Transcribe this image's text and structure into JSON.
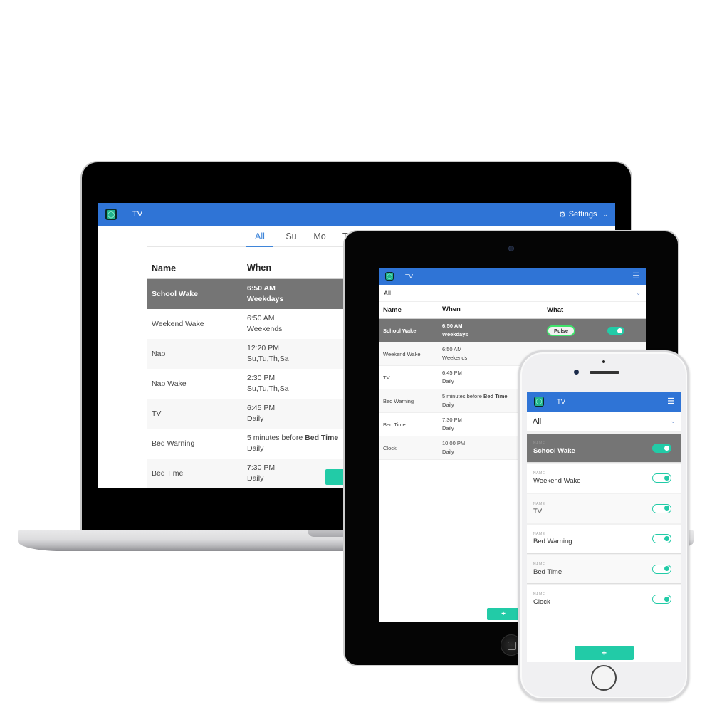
{
  "app": {
    "title": "TV",
    "logo_icon": "lightbulb-icon",
    "accent_color": "#2f74d6",
    "action_color": "#22cba7",
    "selected_row_color": "#757575"
  },
  "laptop": {
    "settings_label": "Settings",
    "settings_icon": "gear-icon",
    "day_tabs": [
      "All",
      "Su",
      "Mo",
      "Tu"
    ],
    "active_tab": "All",
    "columns": {
      "name": "Name",
      "when": "When"
    },
    "rows": [
      {
        "name": "School Wake",
        "time": "6:50 AM",
        "days": "Weekdays",
        "selected": true
      },
      {
        "name": "Weekend Wake",
        "time": "6:50 AM",
        "days": "Weekends"
      },
      {
        "name": "Nap",
        "time": "12:20 PM",
        "days": "Su,Tu,Th,Sa"
      },
      {
        "name": "Nap Wake",
        "time": "2:30 PM",
        "days": "Su,Tu,Th,Sa"
      },
      {
        "name": "TV",
        "time": "6:45 PM",
        "days": "Daily"
      },
      {
        "name": "Bed Warning",
        "time_prefix": "5 minutes before ",
        "time_ref": "Bed Time",
        "days": "Daily"
      },
      {
        "name": "Bed Time",
        "time": "7:30 PM",
        "days": "Daily"
      }
    ]
  },
  "tablet": {
    "filter_value": "All",
    "columns": {
      "name": "Name",
      "when": "When",
      "what": "What"
    },
    "rows": [
      {
        "name": "School Wake",
        "time": "6:50 AM",
        "days": "Weekdays",
        "what": "Pulse",
        "enabled": true,
        "selected": true
      },
      {
        "name": "Weekend Wake",
        "time": "6:50 AM",
        "days": "Weekends"
      },
      {
        "name": "TV",
        "time": "6:45 PM",
        "days": "Daily"
      },
      {
        "name": "Bed Warning",
        "time_prefix": "5 minutes before ",
        "time_ref": "Bed Time",
        "days": "Daily"
      },
      {
        "name": "Bed Time",
        "time": "7:30 PM",
        "days": "Daily"
      },
      {
        "name": "Clock",
        "time": "10:00 PM",
        "days": "Daily"
      }
    ],
    "add_label": "+"
  },
  "phone": {
    "filter_value": "All",
    "field_label": "NAME",
    "cards": [
      {
        "name": "School Wake",
        "enabled": true,
        "selected": true
      },
      {
        "name": "Weekend Wake",
        "enabled": true
      },
      {
        "name": "TV",
        "enabled": true
      },
      {
        "name": "Bed Warning",
        "enabled": true
      },
      {
        "name": "Bed Time",
        "enabled": true
      },
      {
        "name": "Clock",
        "enabled": true
      }
    ],
    "add_label": "+"
  }
}
